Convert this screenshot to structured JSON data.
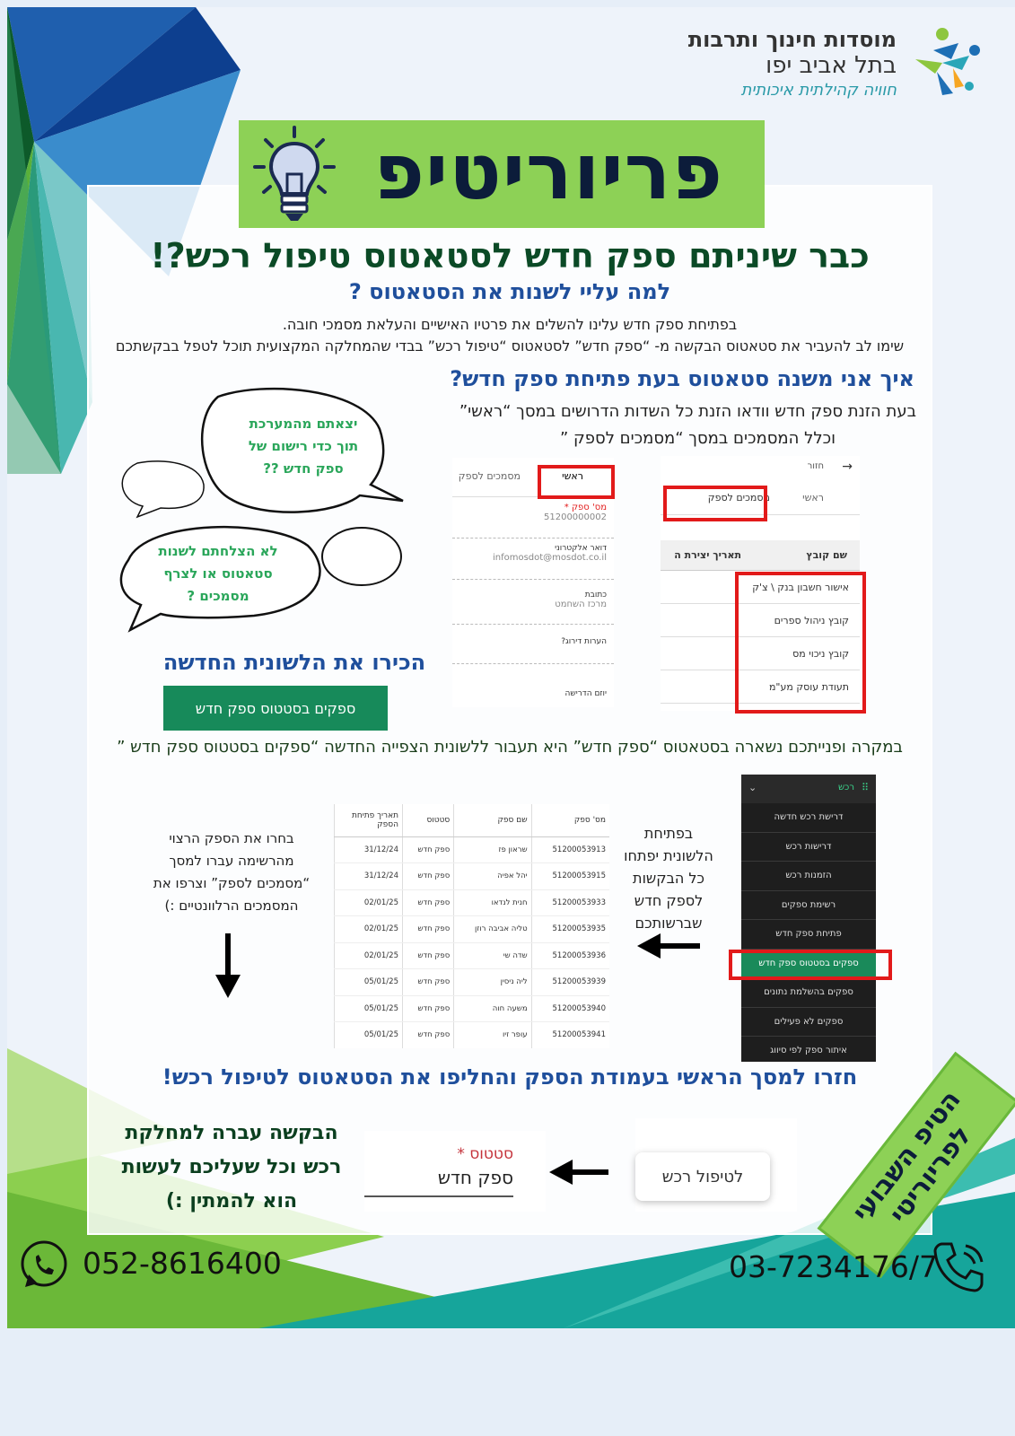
{
  "logo": {
    "line1": "מוסדות חינוך ותרבות",
    "line2": "בתל אביב יפו",
    "line3": "חוויה קהילתית איכותית"
  },
  "banner": {
    "title": "פריוריטיפ"
  },
  "headline": "כבר שיניתם ספק חדש לסטאטוס טיפול רכש?!",
  "why": {
    "title": "למה עליי לשנות את הסטאטוס ?",
    "line1": "בפתיחת ספק חדש עלינו להשלים את פרטיו האישיים והעלאת מסמכי חובה.",
    "line2": "שימו לב להעביר את סטאטוס הבקשה מ- “ספק חדש” לסטאטוס “טיפול רכש” בבדי שהמחלקה המקצועית תוכל לטפל בבקשתכם"
  },
  "how": {
    "title": "איך אני משנה סטאטוס בעת פתיחת ספק חדש?",
    "line1": "בעת הזנת ספק חדש וודאו הזנת כל השדות הדרושים במסך “ראשי”",
    "line2": "וכלל המסמכים במסך “מסמכים לספק ”"
  },
  "bubbles": {
    "b1": [
      "יצאתם מהמערכת",
      "תוך כדי רישום של",
      "ספק חדש ??"
    ],
    "b2": [
      "לא הצלחתם לשנות",
      "סטאטוס או לצרף",
      "מסמכים ?"
    ]
  },
  "meet": {
    "title": "הכירו את הלשונית החדשה",
    "button": "ספקים בסטטוס ספק חדש"
  },
  "case_line": "במקרה ופנייתכם נשארה בסטאטוס “ספק חדש” היא תעבור ללשונית הצפייה החדשה  “ספקים בסטטוס ספק חדש ”",
  "form_shot": {
    "tab_main": "ראשי",
    "tab_docs": "מסמכים לספק",
    "fields": [
      {
        "label": "מס' ספק *",
        "value": "51200000002"
      },
      {
        "label": "דואר אלקטרוני",
        "value": "infomosdot@mosdot.co.il"
      },
      {
        "label": "כתובת",
        "value": "מרכז השחמט"
      },
      {
        "label": "הערות דירוג?",
        "value": ""
      },
      {
        "label": "",
        "value": ""
      },
      {
        "label": "יוזם הדרישה",
        "value": ""
      }
    ]
  },
  "docs_shot": {
    "back": "חזור",
    "tab_main": "ראשי",
    "tab_docs": "מסמכים לספק",
    "col_name": "שם קובץ",
    "col_date": "תאריך יצירת ה",
    "rows": [
      "אישור חשבון בנק \\ צ'ק",
      "קובץ ניהול ספרים",
      "קובץ ניכוי מס",
      "תעודת עוסק מע\"מ"
    ]
  },
  "menu_shot": {
    "header": "רכש",
    "items": [
      "דרישת רכש חדשה",
      "דרישות רכש",
      "הזמנות רכש",
      "רשימת ספקים",
      "פתיחת ספק חדש",
      "ספקים בסטטוס ספק חדש",
      "ספקים בהשלמת נתונים",
      "ספקים לא פעילים",
      "איתור ספק לפי סיווג"
    ],
    "highlight_index": 5
  },
  "table_shot": {
    "headers": [
      "מס' ספק",
      "שם ספק",
      "סטטוס",
      "תאריך פתיחת הספק"
    ],
    "rows": [
      [
        "51200053913",
        "שראון פז",
        "ספק חדש",
        "31/12/24"
      ],
      [
        "51200053915",
        "יהל אפיה",
        "ספק חדש",
        "31/12/24"
      ],
      [
        "51200053933",
        "חנית לנדאו",
        "ספק חדש",
        "02/01/25"
      ],
      [
        "51200053935",
        "טליה אביבה רוזן",
        "ספק חדש",
        "02/01/25"
      ],
      [
        "51200053936",
        "שדה שי",
        "ספק חדש",
        "02/01/25"
      ],
      [
        "51200053939",
        "ליה ניסין",
        "ספק חדש",
        "05/01/25"
      ],
      [
        "51200053940",
        "משעה חוה",
        "ספק חדש",
        "05/01/25"
      ],
      [
        "51200053941",
        "עופר זיו",
        "ספק חדש",
        "05/01/25"
      ]
    ]
  },
  "side_open": [
    "בפתיחת",
    "הלשונית יפתחו",
    "כל הבקשות",
    "לספק חדש",
    "שברשותכם"
  ],
  "side_choose": [
    "בחרו את הספק הרצוי",
    "מהרשימה  עברו למסך",
    "“מסמכים לספק” וצרפו את",
    "המסמכים הרלוונטיים :)"
  ],
  "back_title": "חזרו למסך הראשי בעמודת הספק והחליפו את הסטאטוס לטיפול רכש!",
  "end_text": [
    "הבקשה עברה למחלקת",
    "רכש וכל שעליכם לעשות",
    "הוא להמתין :)"
  ],
  "status_box": {
    "label": "סטטוס *",
    "value": "ספק חדש"
  },
  "treat_button": "לטיפול רכש",
  "tip_badge": [
    "הטיפ השבועי",
    "לפריוריטי"
  ],
  "phones": {
    "whatsapp": "052-8616400",
    "office": "03-7234176/7"
  },
  "colors": {
    "green": "#8dd156",
    "blue_title": "#1f4f9c",
    "dark_green": "#0b4a26",
    "red_box": "#e21a1a"
  }
}
